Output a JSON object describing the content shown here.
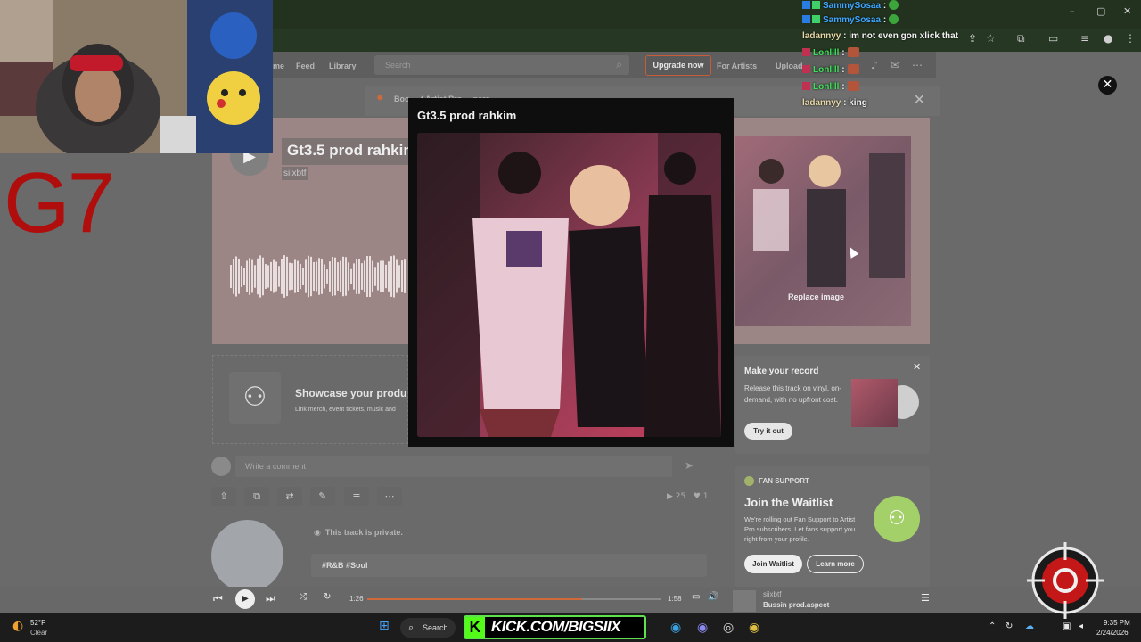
{
  "browser": {
    "window_controls": [
      "–",
      "▢",
      "✕"
    ]
  },
  "soundcloud_nav": {
    "home_label": "me",
    "feed_label": "Feed",
    "library_label": "Library",
    "search_placeholder": "Search",
    "upgrade_label": "Upgrade now",
    "for_artists_label": "For Artists",
    "upload_label": "Upload"
  },
  "banner": {
    "text": "Boo ... t Artist Pro ... ners",
    "close_label": "✕"
  },
  "track": {
    "title": "Gt3.5 prod rahkim",
    "artist": "siixbtf",
    "replace_image_label": "Replace image"
  },
  "showcase": {
    "title": "Showcase your produ",
    "subtitle": "Link merch, event tickets, music and"
  },
  "comment": {
    "placeholder": "Write a comment"
  },
  "stats": {
    "plays": "25",
    "likes": "1"
  },
  "private_notice": "This track is private.",
  "tags": "#R&B  #Soul",
  "record_card": {
    "title": "Make your record",
    "description": "Release this track on vinyl, on-demand, with no upfront cost.",
    "button_label": "Try it out",
    "close_label": "✕"
  },
  "fan_support": {
    "label": "FAN SUPPORT",
    "title": "Join the Waitlist",
    "description": "We're rolling out Fan Support to Artist Pro subscribers. Let fans support you right from your profile.",
    "join_label": "Join Waitlist",
    "learn_label": "Learn more"
  },
  "player": {
    "current_time": "1:26",
    "duration": "1:58",
    "progress_fraction": 0.73,
    "now_playing_artist": "siixbtf",
    "now_playing_title": "Bussin prod.aspect"
  },
  "modal": {
    "title": "Gt3.5 prod rahkim",
    "close_label": "✕"
  },
  "stream_overlay": {
    "brand_text": "G7",
    "kick_text": "KICK.COM/BIGSIIX",
    "chat": [
      {
        "user": "SammySosaa",
        "message": "",
        "user_color": "blue"
      },
      {
        "user": "SammySosaa",
        "message": "",
        "user_color": "blue"
      },
      {
        "user": "ladannyy",
        "message": "im not even gon xlick that",
        "user_color": "tan"
      },
      {
        "user": "Lonllll",
        "message": "",
        "user_color": "green"
      },
      {
        "user": "Lonllll",
        "message": "",
        "user_color": "green"
      },
      {
        "user": "Lonllll",
        "message": "",
        "user_color": "green"
      },
      {
        "user": "ladannyy",
        "message": "king",
        "user_color": "tan"
      }
    ]
  },
  "taskbar": {
    "weather_temp": "52°F",
    "weather_desc": "Clear",
    "search_label": "Search",
    "time": "9:35 PM",
    "date": "2/24/2026"
  }
}
